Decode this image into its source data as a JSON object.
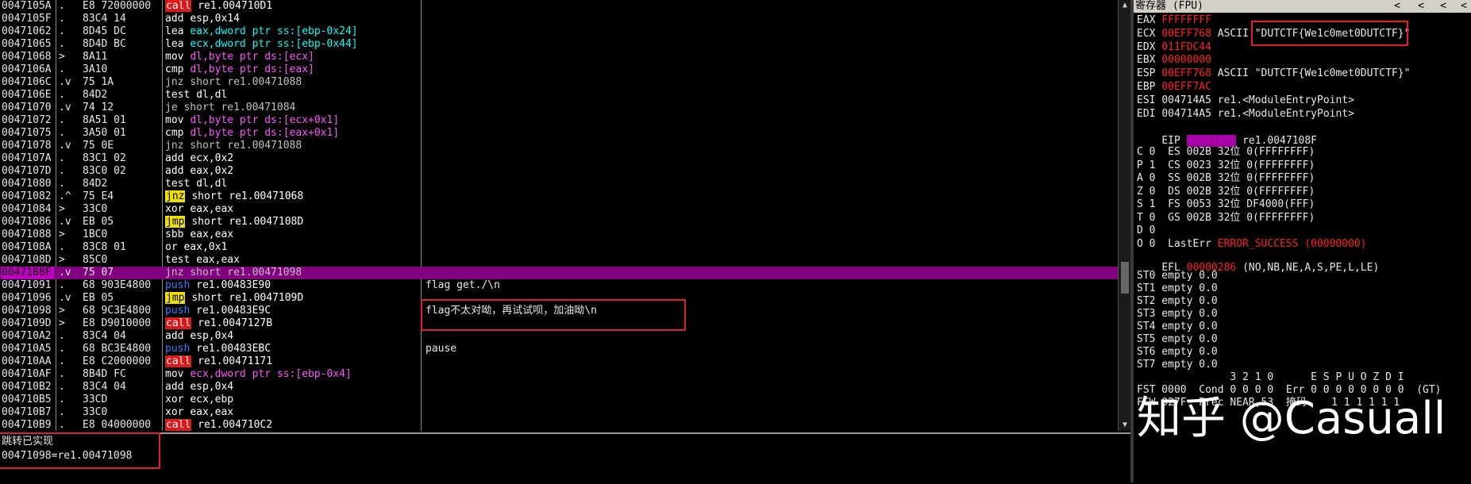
{
  "disasm": {
    "rows": [
      {
        "addr": "0047105A",
        "mark": ".",
        "bytes": "E8 72000000",
        "mn": "call",
        "mn_type": "call",
        "ops": "re1.004710D1",
        "comment": ""
      },
      {
        "addr": "0047105F",
        "mark": ".",
        "bytes": "83C4 14",
        "mn": "add",
        "mn_type": "plain",
        "ops": "esp,0x14",
        "comment": ""
      },
      {
        "addr": "00471062",
        "mark": ".",
        "bytes": "8D45 DC",
        "mn": "lea",
        "mn_type": "plain",
        "ops": "eax,dword ptr ss:[ebp-0x24]",
        "comment": ""
      },
      {
        "addr": "00471065",
        "mark": ".",
        "bytes": "8D4D BC",
        "mn": "lea",
        "mn_type": "plain",
        "ops": "ecx,dword ptr ss:[ebp-0x44]",
        "comment": ""
      },
      {
        "addr": "00471068",
        "mark": ">",
        "bytes": "8A11",
        "mn": "mov",
        "mn_type": "plain",
        "ops": "dl,byte ptr ds:[ecx]",
        "comment": ""
      },
      {
        "addr": "0047106A",
        "mark": ".",
        "bytes": "3A10",
        "mn": "cmp",
        "mn_type": "plain",
        "ops": "dl,byte ptr ds:[eax]",
        "comment": ""
      },
      {
        "addr": "0047106C",
        "mark": ".v",
        "bytes": "75 1A",
        "mn": "jnz",
        "mn_type": "jcc",
        "ops": "short re1.00471088",
        "comment": ""
      },
      {
        "addr": "0047106E",
        "mark": ".",
        "bytes": "84D2",
        "mn": "test",
        "mn_type": "plain",
        "ops": "dl,dl",
        "comment": ""
      },
      {
        "addr": "00471070",
        "mark": ".v",
        "bytes": "74 12",
        "mn": "je",
        "mn_type": "jcc",
        "ops": "short re1.00471084",
        "comment": ""
      },
      {
        "addr": "00471072",
        "mark": ".",
        "bytes": "8A51 01",
        "mn": "mov",
        "mn_type": "plain",
        "ops": "dl,byte ptr ds:[ecx+0x1]",
        "comment": ""
      },
      {
        "addr": "00471075",
        "mark": ".",
        "bytes": "3A50 01",
        "mn": "cmp",
        "mn_type": "plain",
        "ops": "dl,byte ptr ds:[eax+0x1]",
        "comment": ""
      },
      {
        "addr": "00471078",
        "mark": ".v",
        "bytes": "75 0E",
        "mn": "jnz",
        "mn_type": "jcc",
        "ops": "short re1.00471088",
        "comment": ""
      },
      {
        "addr": "0047107A",
        "mark": ".",
        "bytes": "83C1 02",
        "mn": "add",
        "mn_type": "plain",
        "ops": "ecx,0x2",
        "comment": ""
      },
      {
        "addr": "0047107D",
        "mark": ".",
        "bytes": "83C0 02",
        "mn": "add",
        "mn_type": "plain",
        "ops": "eax,0x2",
        "comment": ""
      },
      {
        "addr": "00471080",
        "mark": ".",
        "bytes": "84D2",
        "mn": "test",
        "mn_type": "plain",
        "ops": "dl,dl",
        "comment": ""
      },
      {
        "addr": "00471082",
        "mark": ".^",
        "bytes": "75 E4",
        "mn": "jnz",
        "mn_type": "jmp",
        "ops": "short re1.00471068",
        "comment": ""
      },
      {
        "addr": "00471084",
        "mark": ">",
        "bytes": "33C0",
        "mn": "xor",
        "mn_type": "plain",
        "ops": "eax,eax",
        "comment": ""
      },
      {
        "addr": "00471086",
        "mark": ".v",
        "bytes": "EB 05",
        "mn": "jmp",
        "mn_type": "jmp",
        "ops": "short re1.0047108D",
        "comment": ""
      },
      {
        "addr": "00471088",
        "mark": ">",
        "bytes": "1BC0",
        "mn": "sbb",
        "mn_type": "plain",
        "ops": "eax,eax",
        "comment": ""
      },
      {
        "addr": "0047108A",
        "mark": ".",
        "bytes": "83C8 01",
        "mn": "or",
        "mn_type": "plain",
        "ops": "eax,0x1",
        "comment": ""
      },
      {
        "addr": "0047108D",
        "mark": ">",
        "bytes": "85C0",
        "mn": "test",
        "mn_type": "plain",
        "ops": "eax,eax",
        "comment": ""
      },
      {
        "addr": "0047108F",
        "mark": ".v",
        "bytes": "75 07",
        "mn": "jnz",
        "mn_type": "jcc",
        "ops": "short re1.00471098",
        "comment": "",
        "selected": true
      },
      {
        "addr": "00471091",
        "mark": ".",
        "bytes": "68 903E4800",
        "mn": "push",
        "mn_type": "push",
        "ops": "re1.00483E90",
        "comment": "flag get./\\n"
      },
      {
        "addr": "00471096",
        "mark": ".v",
        "bytes": "EB 05",
        "mn": "jmp",
        "mn_type": "jmp",
        "ops": "short re1.0047109D",
        "comment": ""
      },
      {
        "addr": "00471098",
        "mark": ">",
        "bytes": "68 9C3E4800",
        "mn": "push",
        "mn_type": "push",
        "ops": "re1.00483E9C",
        "comment": "flag不太对呦，再试试呗，加油呦\\n"
      },
      {
        "addr": "0047109D",
        "mark": ">",
        "bytes": "E8 D9010000",
        "mn": "call",
        "mn_type": "call",
        "ops": "re1.0047127B",
        "comment": ""
      },
      {
        "addr": "004710A2",
        "mark": ".",
        "bytes": "83C4 04",
        "mn": "add",
        "mn_type": "plain",
        "ops": "esp,0x4",
        "comment": ""
      },
      {
        "addr": "004710A5",
        "mark": ".",
        "bytes": "68 BC3E4800",
        "mn": "push",
        "mn_type": "push",
        "ops": "re1.00483EBC",
        "comment": "pause"
      },
      {
        "addr": "004710AA",
        "mark": ".",
        "bytes": "E8 C2000000",
        "mn": "call",
        "mn_type": "call",
        "ops": "re1.00471171",
        "comment": ""
      },
      {
        "addr": "004710AF",
        "mark": ".",
        "bytes": "8B4D FC",
        "mn": "mov",
        "mn_type": "plain",
        "ops": "ecx,dword ptr ss:[ebp-0x4]",
        "comment": ""
      },
      {
        "addr": "004710B2",
        "mark": ".",
        "bytes": "83C4 04",
        "mn": "add",
        "mn_type": "plain",
        "ops": "esp,0x4",
        "comment": ""
      },
      {
        "addr": "004710B5",
        "mark": ".",
        "bytes": "33CD",
        "mn": "xor",
        "mn_type": "plain",
        "ops": "ecx,ebp",
        "comment": ""
      },
      {
        "addr": "004710B7",
        "mark": ".",
        "bytes": "33C0",
        "mn": "xor",
        "mn_type": "plain",
        "ops": "eax,eax",
        "comment": ""
      },
      {
        "addr": "004710B9",
        "mark": ".",
        "bytes": "E8 04000000",
        "mn": "call",
        "mn_type": "call",
        "ops": "re1.004710C2",
        "comment": ""
      }
    ]
  },
  "info": {
    "line1": "跳转已实现",
    "line2": "00471098=re1.00471098"
  },
  "regs": {
    "title": "寄存器 (FPU)",
    "nav_arrows": [
      "<",
      "<",
      "<",
      "<"
    ],
    "general": [
      {
        "name": "EAX",
        "value": "FFFFFFFF",
        "note": ""
      },
      {
        "name": "ECX",
        "value": "00EFF768",
        "note": "ASCII \"DUTCTF{We1c0met0DUTCTF}\""
      },
      {
        "name": "EDX",
        "value": "011FDC44",
        "note": ""
      },
      {
        "name": "EBX",
        "value": "00000000",
        "note": ""
      },
      {
        "name": "ESP",
        "value": "00EFF768",
        "note": "ASCII \"DUTCTF{We1c0met0DUTCTF}\""
      },
      {
        "name": "EBP",
        "value": "00EFF7AC",
        "note": ""
      },
      {
        "name": "ESI",
        "value": "004714A5",
        "note": "re1.<ModuleEntryPoint>",
        "plain": true
      },
      {
        "name": "EDI",
        "value": "004714A5",
        "note": "re1.<ModuleEntryPoint>",
        "plain": true
      }
    ],
    "eip": {
      "name": "EIP",
      "value": "0047108F",
      "note": "re1.0047108F"
    },
    "segments": [
      "C 0  ES 002B 32位 0(FFFFFFFF)",
      "P 1  CS 0023 32位 0(FFFFFFFF)",
      "A 0  SS 002B 32位 0(FFFFFFFF)",
      "Z 0  DS 002B 32位 0(FFFFFFFF)",
      "S 1  FS 0053 32位 DF4000(FFF)",
      "T 0  GS 002B 32位 0(FFFFFFFF)",
      "D 0",
      "O 0  LastErr "
    ],
    "lasterr": "ERROR_SUCCESS (00000000)",
    "efl_label": "EFL",
    "efl_value": "00000286",
    "efl_note": "(NO,NB,NE,A,S,PE,L,LE)",
    "fpu": [
      "ST0 empty 0.0",
      "ST1 empty 0.0",
      "ST2 empty 0.0",
      "ST3 empty 0.0",
      "ST4 empty 0.0",
      "ST5 empty 0.0",
      "ST6 empty 0.0",
      "ST7 empty 0.0"
    ],
    "fst_header": "               3 2 1 0      E S P U O Z D I",
    "fst_line": "FST 0000  Cond 0 0 0 0  Err 0 0 0 0 0 0 0 0  (GT)",
    "fcw_line": "FCW 027F  Prec NEAR,53  掩码    1 1 1 1 1 1"
  },
  "watermark": "知乎 @Casuall",
  "colors": {
    "call_bg": "#e01818",
    "jmp_bg": "#f0e000",
    "selected_row": "#80007f",
    "reg_red": "#ff2020",
    "highlight_box": "#e02030"
  }
}
